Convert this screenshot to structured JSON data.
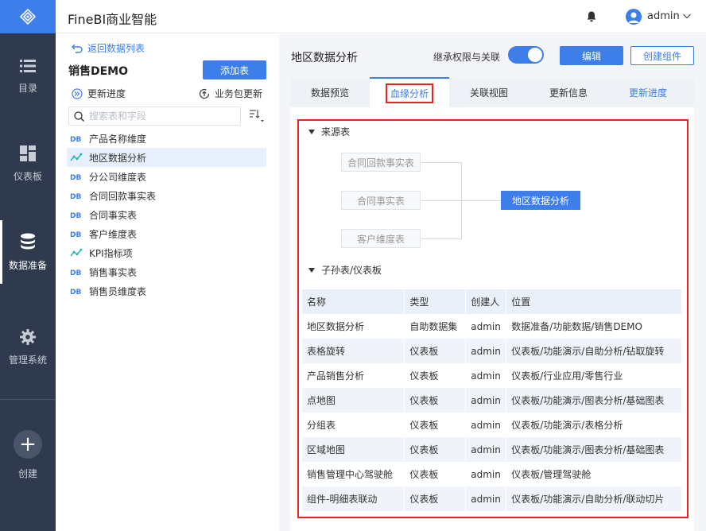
{
  "app": {
    "title": "FineBI商业智能"
  },
  "user": {
    "name": "admin"
  },
  "nav": {
    "items": [
      {
        "label": "目录",
        "icon": "list-icon"
      },
      {
        "label": "仪表板",
        "icon": "dashboard-icon"
      },
      {
        "label": "数据准备",
        "icon": "database-icon"
      },
      {
        "label": "管理系统",
        "icon": "gear-icon"
      },
      {
        "label": "创建",
        "icon": "plus-icon"
      }
    ]
  },
  "panel": {
    "back_label": "返回数据列表",
    "package_title": "销售DEMO",
    "add_table_label": "添加表",
    "update_progress_label": "更新进度",
    "business_update_label": "业务包更新",
    "search_placeholder": "搜索表和字段",
    "tables": [
      {
        "name": "产品名称维度",
        "type": "db"
      },
      {
        "name": "地区数据分析",
        "type": "analysis"
      },
      {
        "name": "分公司维度表",
        "type": "db"
      },
      {
        "name": "合同回款事实表",
        "type": "db"
      },
      {
        "name": "合同事实表",
        "type": "db"
      },
      {
        "name": "客户维度表",
        "type": "db"
      },
      {
        "name": "KPI指标项",
        "type": "analysis"
      },
      {
        "name": "销售事实表",
        "type": "db"
      },
      {
        "name": "销售员维度表",
        "type": "db"
      }
    ]
  },
  "content": {
    "title": "地区数据分析",
    "inherit_label": "继承权限与关联",
    "edit_label": "编辑",
    "create_component_label": "创建组件",
    "tabs": [
      "数据预览",
      "血缘分析",
      "关联视图",
      "更新信息",
      "更新进度"
    ],
    "source_section": "来源表",
    "source_nodes": [
      "合同回款事实表",
      "合同事实表",
      "客户维度表"
    ],
    "target_node": "地区数据分析",
    "child_section": "子孙表/仪表板",
    "table": {
      "headers": [
        "名称",
        "类型",
        "创建人",
        "位置"
      ],
      "rows": [
        [
          "地区数据分析",
          "自助数据集",
          "admin",
          "数据准备/功能数据/销售DEMO"
        ],
        [
          "表格旋转",
          "仪表板",
          "admin",
          "仪表板/功能演示/自助分析/钻取旋转"
        ],
        [
          "产品销售分析",
          "仪表板",
          "admin",
          "仪表板/行业应用/零售行业"
        ],
        [
          "点地图",
          "仪表板",
          "admin",
          "仪表板/功能演示/图表分析/基础图表"
        ],
        [
          "分组表",
          "仪表板",
          "admin",
          "仪表板/功能演示/表格分析"
        ],
        [
          "区域地图",
          "仪表板",
          "admin",
          "仪表板/功能演示/图表分析/基础图表"
        ],
        [
          "销售管理中心驾驶舱",
          "仪表板",
          "admin",
          "仪表板/管理驾驶舱"
        ],
        [
          "组件-明细表联动",
          "仪表板",
          "admin",
          "仪表板/功能演示/自助分析/联动切片"
        ]
      ]
    }
  }
}
